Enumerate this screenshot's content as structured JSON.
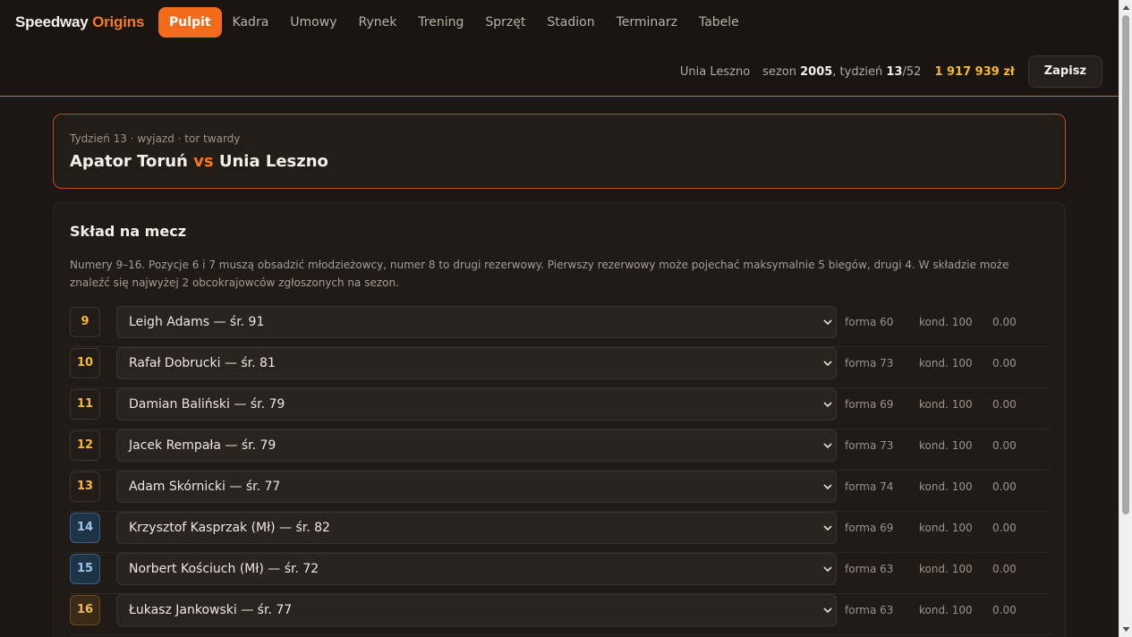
{
  "app": {
    "logo_main": "Speedway",
    "logo_accent": "Origins"
  },
  "nav": {
    "items": [
      {
        "label": "Pulpit",
        "active": true
      },
      {
        "label": "Kadra"
      },
      {
        "label": "Umowy"
      },
      {
        "label": "Rynek"
      },
      {
        "label": "Trening"
      },
      {
        "label": "Sprzęt"
      },
      {
        "label": "Stadion"
      },
      {
        "label": "Terminarz"
      },
      {
        "label": "Tabele"
      }
    ]
  },
  "status": {
    "team": "Unia Leszno",
    "season_label": "sezon",
    "season": "2005",
    "week_label": ", tydzień",
    "week": "13",
    "week_total": "/52",
    "money": "1 917 939 zł",
    "save_label": "Zapisz"
  },
  "match": {
    "meta": "Tydzień 13 · wyjazd · tor twardy",
    "home": "Apator Toruń",
    "vs": "vs",
    "away": "Unia Leszno"
  },
  "squad": {
    "title": "Skład na mecz",
    "description": "Numery 9–16. Pozycje 6 i 7 muszą obsadzić młodzieżowcy, numer 8 to drugi rezerwowy. Pierwszy rezerwowy może pojechać maksymalnie 5 biegów, drugi 4. W składzie może znaleźć się najwyżej 2 obcokrajowców zgłoszonych na sezon.",
    "rows": [
      {
        "num": "9",
        "rider": "Leigh Adams — śr. 91",
        "forma": "forma 60",
        "kond": "kond. 100",
        "value": "0.00",
        "kind": "regular"
      },
      {
        "num": "10",
        "rider": "Rafał Dobrucki — śr. 81",
        "forma": "forma 73",
        "kond": "kond. 100",
        "value": "0.00",
        "kind": "regular"
      },
      {
        "num": "11",
        "rider": "Damian Baliński — śr. 79",
        "forma": "forma 69",
        "kond": "kond. 100",
        "value": "0.00",
        "kind": "regular"
      },
      {
        "num": "12",
        "rider": "Jacek Rempała — śr. 79",
        "forma": "forma 73",
        "kond": "kond. 100",
        "value": "0.00",
        "kind": "regular"
      },
      {
        "num": "13",
        "rider": "Adam Skórnicki — śr. 77",
        "forma": "forma 74",
        "kond": "kond. 100",
        "value": "0.00",
        "kind": "regular"
      },
      {
        "num": "14",
        "rider": "Krzysztof Kasprzak (Mł) — śr. 82",
        "forma": "forma 69",
        "kond": "kond. 100",
        "value": "0.00",
        "kind": "junior"
      },
      {
        "num": "15",
        "rider": "Norbert Kościuch (Mł) — śr. 72",
        "forma": "forma 63",
        "kond": "kond. 100",
        "value": "0.00",
        "kind": "junior"
      },
      {
        "num": "16",
        "rider": "Łukasz Jankowski — śr. 77",
        "forma": "forma 63",
        "kond": "kond. 100",
        "value": "0.00",
        "kind": "reserve"
      }
    ]
  },
  "colors": {
    "accent": "#f26b1d",
    "money": "#f6b830",
    "junior": "#1f3347",
    "reserve": "#3a2a18"
  }
}
